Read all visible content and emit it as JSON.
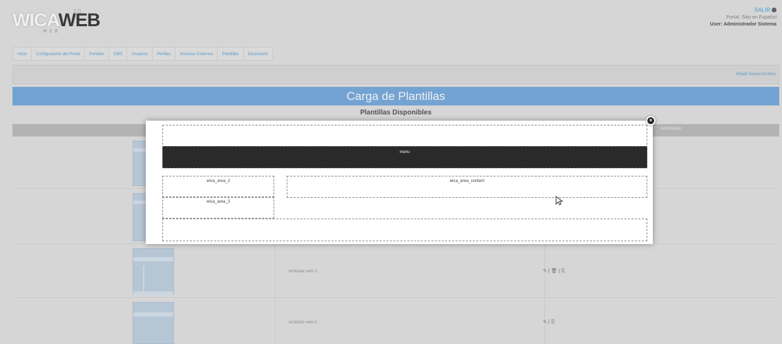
{
  "header": {
    "logo_part1": "WICA",
    "logo_part2": "WEB",
    "logo_sup": "2.0",
    "logo_sub": "WEB",
    "logout_label": "SALIR",
    "portal_line": "Portal: Sitio en Español",
    "user_line": "User: Administrador Sistema"
  },
  "nav": {
    "items": [
      "Inicio",
      "Configuración del Portal",
      "Portales",
      "CMS",
      "Usuarios",
      "Perfiles",
      "Archivos Externos",
      "Plantillas",
      "Diccionario"
    ]
  },
  "toolbar": {
    "add_file_label": "Añadir Nuevo Archivo"
  },
  "page": {
    "title": "Carga de Plantillas",
    "section_title": "Plantillas Disponibles"
  },
  "table": {
    "header_action": "Administrar",
    "rows": [
      {
        "name": "",
        "actions": ""
      },
      {
        "name": "",
        "actions": ""
      },
      {
        "name": "template web 3",
        "actions": "✎ | 🗑 | ⎘"
      },
      {
        "name": "template web 4",
        "actions": "✎ | ⎘"
      }
    ]
  },
  "modal": {
    "menu_label": "menu",
    "area2_label": "wica_area_2",
    "area3_label": "wica_area_3",
    "content_label": "wica_area_content",
    "close_icon": "close-icon"
  },
  "colors": {
    "accent": "#7baee0",
    "link": "#5fa5d6",
    "menu_bg": "#2a2a2a"
  }
}
